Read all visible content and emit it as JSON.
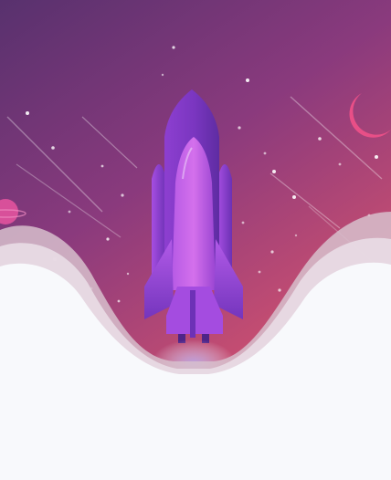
{
  "illustration": {
    "subject": "rocket-launch",
    "icons": [
      "rocket-icon",
      "crescent-moon-icon",
      "planet-icon",
      "star-icon",
      "shooting-star-icon"
    ]
  },
  "colors": {
    "sky_top": "#5b336f",
    "sky_mid": "#8b3a7c",
    "sky_bottom": "#d9556f",
    "moon": "#e84f87",
    "rocket_light": "#c262e6",
    "rocket_dark": "#6a32a8",
    "rocket_mid": "#9747d4",
    "cloud": "#f8f9fc",
    "cloud_shadow": "#d9c3cf"
  }
}
